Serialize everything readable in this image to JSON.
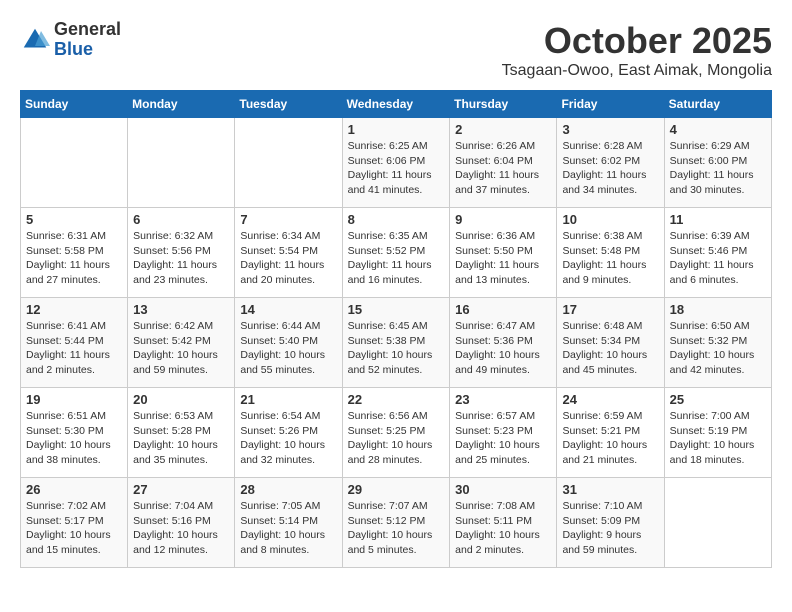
{
  "header": {
    "logo_general": "General",
    "logo_blue": "Blue",
    "month_title": "October 2025",
    "subtitle": "Tsagaan-Owoo, East Aimak, Mongolia"
  },
  "calendar": {
    "days_of_week": [
      "Sunday",
      "Monday",
      "Tuesday",
      "Wednesday",
      "Thursday",
      "Friday",
      "Saturday"
    ],
    "weeks": [
      [
        {
          "day": "",
          "info": ""
        },
        {
          "day": "",
          "info": ""
        },
        {
          "day": "",
          "info": ""
        },
        {
          "day": "1",
          "info": "Sunrise: 6:25 AM\nSunset: 6:06 PM\nDaylight: 11 hours and 41 minutes."
        },
        {
          "day": "2",
          "info": "Sunrise: 6:26 AM\nSunset: 6:04 PM\nDaylight: 11 hours and 37 minutes."
        },
        {
          "day": "3",
          "info": "Sunrise: 6:28 AM\nSunset: 6:02 PM\nDaylight: 11 hours and 34 minutes."
        },
        {
          "day": "4",
          "info": "Sunrise: 6:29 AM\nSunset: 6:00 PM\nDaylight: 11 hours and 30 minutes."
        }
      ],
      [
        {
          "day": "5",
          "info": "Sunrise: 6:31 AM\nSunset: 5:58 PM\nDaylight: 11 hours and 27 minutes."
        },
        {
          "day": "6",
          "info": "Sunrise: 6:32 AM\nSunset: 5:56 PM\nDaylight: 11 hours and 23 minutes."
        },
        {
          "day": "7",
          "info": "Sunrise: 6:34 AM\nSunset: 5:54 PM\nDaylight: 11 hours and 20 minutes."
        },
        {
          "day": "8",
          "info": "Sunrise: 6:35 AM\nSunset: 5:52 PM\nDaylight: 11 hours and 16 minutes."
        },
        {
          "day": "9",
          "info": "Sunrise: 6:36 AM\nSunset: 5:50 PM\nDaylight: 11 hours and 13 minutes."
        },
        {
          "day": "10",
          "info": "Sunrise: 6:38 AM\nSunset: 5:48 PM\nDaylight: 11 hours and 9 minutes."
        },
        {
          "day": "11",
          "info": "Sunrise: 6:39 AM\nSunset: 5:46 PM\nDaylight: 11 hours and 6 minutes."
        }
      ],
      [
        {
          "day": "12",
          "info": "Sunrise: 6:41 AM\nSunset: 5:44 PM\nDaylight: 11 hours and 2 minutes."
        },
        {
          "day": "13",
          "info": "Sunrise: 6:42 AM\nSunset: 5:42 PM\nDaylight: 10 hours and 59 minutes."
        },
        {
          "day": "14",
          "info": "Sunrise: 6:44 AM\nSunset: 5:40 PM\nDaylight: 10 hours and 55 minutes."
        },
        {
          "day": "15",
          "info": "Sunrise: 6:45 AM\nSunset: 5:38 PM\nDaylight: 10 hours and 52 minutes."
        },
        {
          "day": "16",
          "info": "Sunrise: 6:47 AM\nSunset: 5:36 PM\nDaylight: 10 hours and 49 minutes."
        },
        {
          "day": "17",
          "info": "Sunrise: 6:48 AM\nSunset: 5:34 PM\nDaylight: 10 hours and 45 minutes."
        },
        {
          "day": "18",
          "info": "Sunrise: 6:50 AM\nSunset: 5:32 PM\nDaylight: 10 hours and 42 minutes."
        }
      ],
      [
        {
          "day": "19",
          "info": "Sunrise: 6:51 AM\nSunset: 5:30 PM\nDaylight: 10 hours and 38 minutes."
        },
        {
          "day": "20",
          "info": "Sunrise: 6:53 AM\nSunset: 5:28 PM\nDaylight: 10 hours and 35 minutes."
        },
        {
          "day": "21",
          "info": "Sunrise: 6:54 AM\nSunset: 5:26 PM\nDaylight: 10 hours and 32 minutes."
        },
        {
          "day": "22",
          "info": "Sunrise: 6:56 AM\nSunset: 5:25 PM\nDaylight: 10 hours and 28 minutes."
        },
        {
          "day": "23",
          "info": "Sunrise: 6:57 AM\nSunset: 5:23 PM\nDaylight: 10 hours and 25 minutes."
        },
        {
          "day": "24",
          "info": "Sunrise: 6:59 AM\nSunset: 5:21 PM\nDaylight: 10 hours and 21 minutes."
        },
        {
          "day": "25",
          "info": "Sunrise: 7:00 AM\nSunset: 5:19 PM\nDaylight: 10 hours and 18 minutes."
        }
      ],
      [
        {
          "day": "26",
          "info": "Sunrise: 7:02 AM\nSunset: 5:17 PM\nDaylight: 10 hours and 15 minutes."
        },
        {
          "day": "27",
          "info": "Sunrise: 7:04 AM\nSunset: 5:16 PM\nDaylight: 10 hours and 12 minutes."
        },
        {
          "day": "28",
          "info": "Sunrise: 7:05 AM\nSunset: 5:14 PM\nDaylight: 10 hours and 8 minutes."
        },
        {
          "day": "29",
          "info": "Sunrise: 7:07 AM\nSunset: 5:12 PM\nDaylight: 10 hours and 5 minutes."
        },
        {
          "day": "30",
          "info": "Sunrise: 7:08 AM\nSunset: 5:11 PM\nDaylight: 10 hours and 2 minutes."
        },
        {
          "day": "31",
          "info": "Sunrise: 7:10 AM\nSunset: 5:09 PM\nDaylight: 9 hours and 59 minutes."
        },
        {
          "day": "",
          "info": ""
        }
      ]
    ]
  }
}
